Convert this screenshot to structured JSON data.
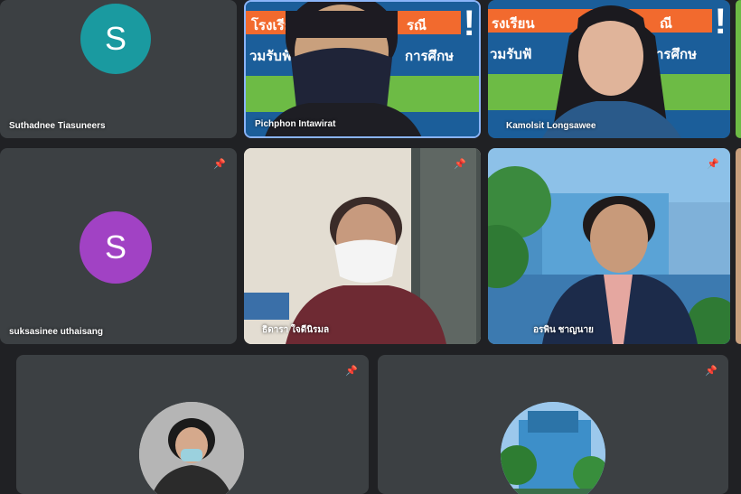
{
  "participants": [
    {
      "name": "Suthadnee Tiasuneers",
      "avatar_letter": "S",
      "avatar_color": "#1a9aa0",
      "type": "avatar"
    },
    {
      "name": "Pichphon Intawirat",
      "type": "video",
      "poster_line1": "โรงเรียน",
      "poster_line2": "วมรับฟัง",
      "poster_right1": "รณี",
      "poster_right2": "การศึกษ"
    },
    {
      "name": "Kamolsit Longsawee",
      "type": "video",
      "poster_line1": "รงเรียน",
      "poster_line2": "วมรับฟั",
      "poster_right1": "ณี",
      "poster_right2": "ารศึกษ"
    },
    {
      "name": "suksasinee uthaisang",
      "avatar_letter": "S",
      "avatar_color": "#a142c4",
      "type": "avatar"
    },
    {
      "name": "ธิดารา ใจดีนิรมล",
      "type": "video"
    },
    {
      "name": "อรพิน ชาญนาย",
      "type": "video"
    },
    {
      "name": "",
      "type": "photo-avatar"
    },
    {
      "name": "",
      "type": "photo-avatar"
    }
  ],
  "pin_icon": "pin-icon",
  "colors": {
    "background": "#202124",
    "tile": "#3c4043"
  }
}
